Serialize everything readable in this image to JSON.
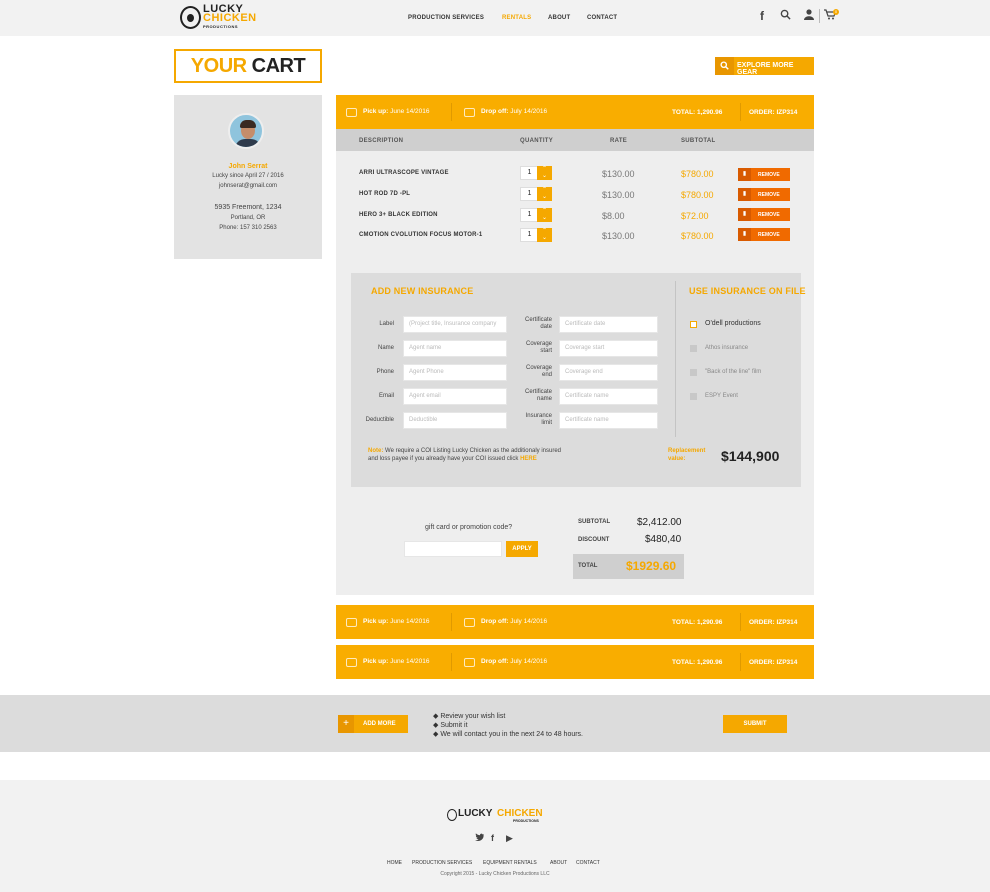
{
  "header": {
    "logo": {
      "line1": "LUCKY",
      "line2": "CHICKEN",
      "line3": "PRODUCTIONS"
    },
    "nav": [
      "PRODUCTION SERVICES",
      "RENTALS",
      "ABOUT",
      "CONTACT"
    ],
    "active_nav": "RENTALS",
    "icons": [
      "facebook-icon",
      "search-icon",
      "user-icon",
      "cart-icon"
    ],
    "cart_count": "0"
  },
  "page": {
    "title_accent": "YOUR",
    "title_rest": "CART",
    "explore_label": "EXPLORE MORE GEAR"
  },
  "profile": {
    "name": "John Serrat",
    "since": "Lucky since April 27 / 2016",
    "email": "johnserat@gmail.com",
    "address1": "5935 Freemont, 1234",
    "address2": "Portland, OR",
    "phone": "Phone: 157 310 2563"
  },
  "orders": [
    {
      "pickup_label": "Pick up:",
      "pickup": "June 14/2016",
      "dropoff_label": "Drop off:",
      "dropoff": "July 14/2016",
      "total": "TOTAL: 1,290.96",
      "order": "ORDER: IZP314"
    },
    {
      "pickup_label": "Pick up:",
      "pickup": "June 14/2016",
      "dropoff_label": "Drop off:",
      "dropoff": "July 14/2016",
      "total": "TOTAL: 1,290.96",
      "order": "ORDER: IZP314"
    },
    {
      "pickup_label": "Pick up:",
      "pickup": "June 14/2016",
      "dropoff_label": "Drop off:",
      "dropoff": "July 14/2016",
      "total": "TOTAL: 1,290.96",
      "order": "ORDER: IZP314"
    }
  ],
  "table": {
    "headers": [
      "DESCRIPTION",
      "QUANTITY",
      "RATE",
      "SUBTOTAL"
    ],
    "remove_label": "REMOVE",
    "rows": [
      {
        "desc": "ARRI ULTRASCOPE VINTAGE",
        "qty": "1",
        "rate": "$130.00",
        "subtotal": "$780.00"
      },
      {
        "desc": "HOT ROD 7D -PL",
        "qty": "1",
        "rate": "$130.00",
        "subtotal": "$780.00"
      },
      {
        "desc": "HERO 3+ BLACK EDITION",
        "qty": "1",
        "rate": "$8.00",
        "subtotal": "$72.00"
      },
      {
        "desc": "CMOTION CVOLUTION FOCUS MOTOR-1",
        "qty": "1",
        "rate": "$130.00",
        "subtotal": "$780.00"
      }
    ]
  },
  "insurance": {
    "new_title": "ADD NEW INSURANCE",
    "file_title": "USE INSURANCE ON FILE",
    "left_fields": [
      {
        "label": "Label",
        "placeholder": "(Project title, Insurance company"
      },
      {
        "label": "Name",
        "placeholder": "Agent name"
      },
      {
        "label": "Phone",
        "placeholder": "Agent Phone"
      },
      {
        "label": "Email",
        "placeholder": "Agent email"
      },
      {
        "label": "Deductible",
        "placeholder": "Deductible"
      }
    ],
    "right_fields": [
      {
        "label1": "Certificate",
        "label2": "date",
        "placeholder": "Certificate date"
      },
      {
        "label1": "Coverage",
        "label2": "start",
        "placeholder": "Coverage start"
      },
      {
        "label1": "Coverage",
        "label2": "end",
        "placeholder": "Coverage end"
      },
      {
        "label1": "Certificate",
        "label2": "name",
        "placeholder": "Certificate name"
      },
      {
        "label1": "Insurance",
        "label2": "limit",
        "placeholder": "Certificate name"
      }
    ],
    "on_file": [
      "O'dell productions",
      "Athos insurance",
      "\"Back of the line\" film",
      "ESPY Event"
    ],
    "note_label": "Note:",
    "note_text1": "We require a COI Listing Lucky Chicken as the additionaly insured",
    "note_text2": "and loss payee if you already have your COI issued click",
    "note_link": "HERE",
    "replacement_label1": "Replacement",
    "replacement_label2": "value:",
    "replacement_value": "$144,900"
  },
  "promo": {
    "label": "gift card or promotion code?",
    "apply": "APPLY"
  },
  "summary": {
    "subtotal_label": "SUBTOTAL",
    "subtotal": "$2,412.00",
    "discount_label": "DISCOUNT",
    "discount": "$480,40",
    "total_label": "TOTAL",
    "total": "$1929.60"
  },
  "actions": {
    "add_more": "ADD MORE",
    "bullets": [
      "Review your wish list",
      "Submit it",
      "We will contact you in the next 24 to 48 hours."
    ],
    "submit": "SUBMIT"
  },
  "footer": {
    "logo1": "LUCKY",
    "logo2": "CHICKEN",
    "logo3": "PRODUCTIONS",
    "social": [
      "twitter-icon",
      "facebook-icon",
      "youtube-icon"
    ],
    "nav": [
      "HOME",
      "PRODUCTION SERVICES",
      "EQUIPMENT RENTALS",
      "ABOUT",
      "CONTACT"
    ],
    "copyright": "Copyright 2015 - Lucky Chicken Productions LLC"
  },
  "colors": {
    "accent": "#f5a800",
    "remove": "#f06a00",
    "panel": "#eeeeee"
  }
}
